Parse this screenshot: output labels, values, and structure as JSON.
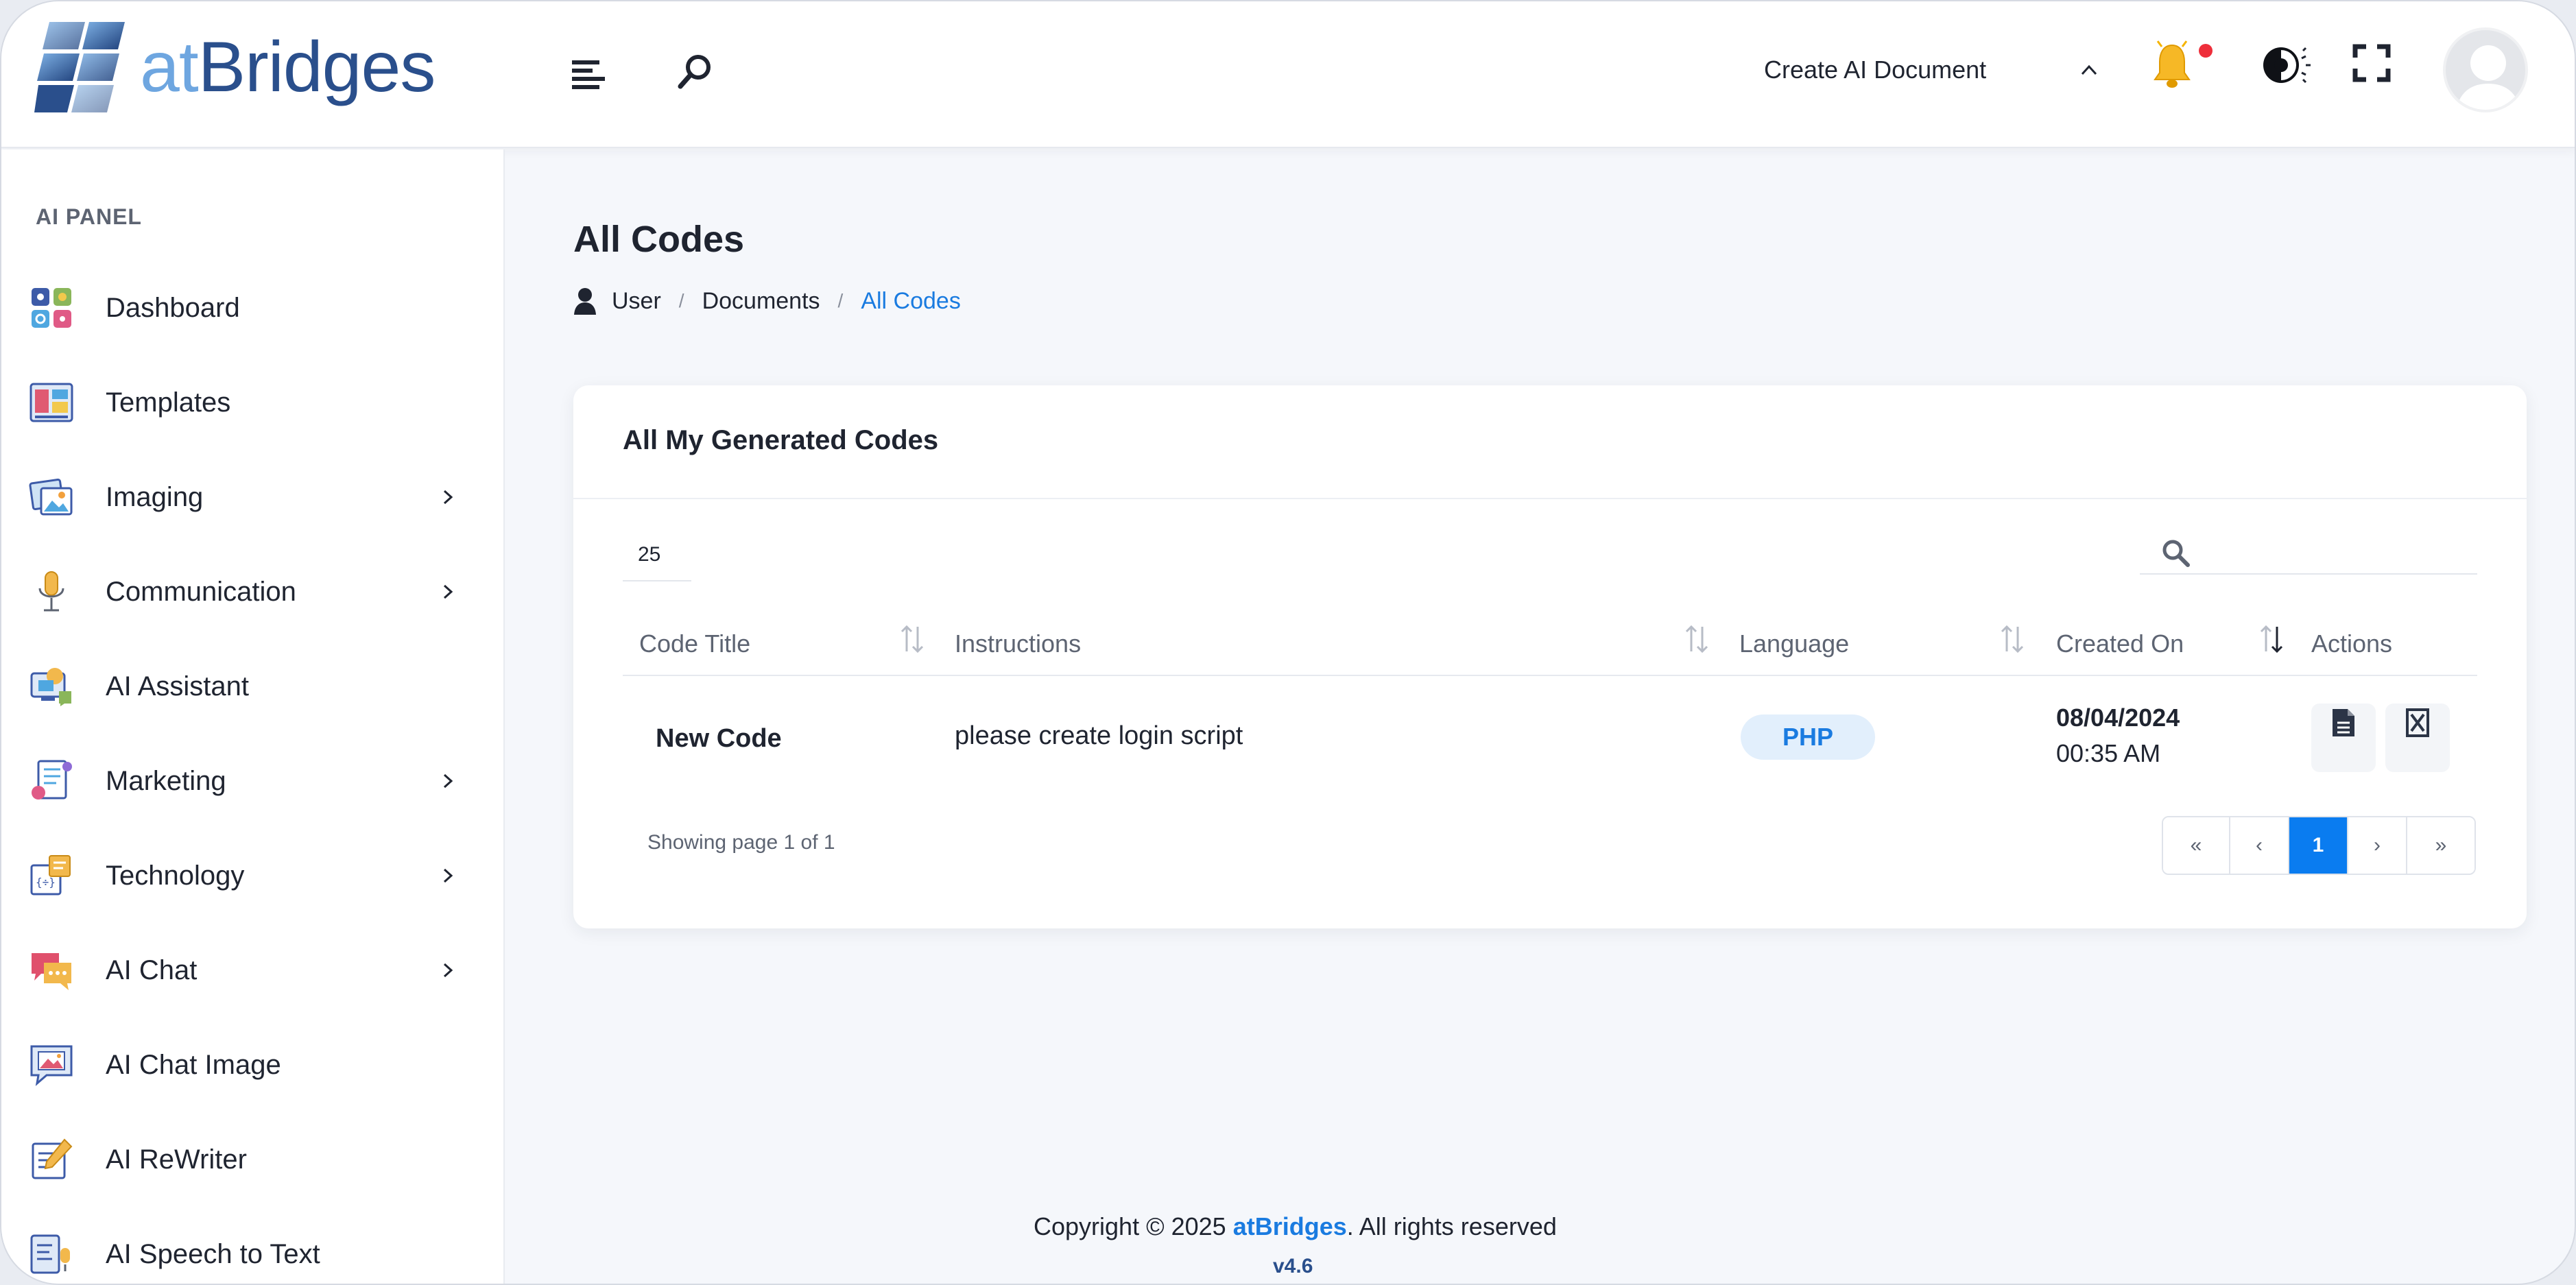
{
  "header": {
    "logo_at": "at",
    "logo_bridges": "Bridges",
    "create_doc_label": "Create AI Document",
    "icons": {
      "menu": "menu-icon",
      "search": "search-icon",
      "notifications": "bell-icon",
      "theme": "theme-toggle-icon",
      "fullscreen": "fullscreen-icon",
      "avatar": "user-avatar"
    },
    "colors": {
      "bell": "#f5b400",
      "notification_dot": "#ee2e3a"
    }
  },
  "sidebar": {
    "panel_title": "AI PANEL",
    "items": [
      {
        "label": "Dashboard",
        "icon": "dashboard-icon",
        "has_children": false
      },
      {
        "label": "Templates",
        "icon": "templates-icon",
        "has_children": false
      },
      {
        "label": "Imaging",
        "icon": "imaging-icon",
        "has_children": true
      },
      {
        "label": "Communication",
        "icon": "microphone-icon",
        "has_children": true
      },
      {
        "label": "AI Assistant",
        "icon": "assistant-icon",
        "has_children": false
      },
      {
        "label": "Marketing",
        "icon": "marketing-icon",
        "has_children": true
      },
      {
        "label": "Technology",
        "icon": "technology-icon",
        "has_children": true
      },
      {
        "label": "AI Chat",
        "icon": "chat-icon",
        "has_children": true
      },
      {
        "label": "AI Chat Image",
        "icon": "chat-image-icon",
        "has_children": false
      },
      {
        "label": "AI ReWriter",
        "icon": "rewriter-icon",
        "has_children": false
      },
      {
        "label": "AI Speech to Text",
        "icon": "speech-to-text-icon",
        "has_children": false
      }
    ]
  },
  "page": {
    "title": "All Codes",
    "breadcrumb": [
      "User",
      "Documents",
      "All Codes"
    ]
  },
  "card": {
    "title": "All My Generated Codes",
    "page_size": "25",
    "search_placeholder": "",
    "columns": [
      "Code Title",
      "Instructions",
      "Language",
      "Created On",
      "Actions"
    ],
    "rows": [
      {
        "title": "New Code",
        "instructions": "please create login script",
        "language": "PHP",
        "created_date": "08/04/2024",
        "created_time": "00:35 AM"
      }
    ],
    "showing": "Showing page 1 of 1",
    "pagination": {
      "first": "«",
      "prev": "‹",
      "current": "1",
      "next": "›",
      "last": "»"
    },
    "accent": "#0a7cf0"
  },
  "footer": {
    "copyright_prefix": "Copyright © 2025 ",
    "brand": "atBridges",
    "copyright_suffix": ". All rights reserved",
    "version": "v4.6"
  }
}
